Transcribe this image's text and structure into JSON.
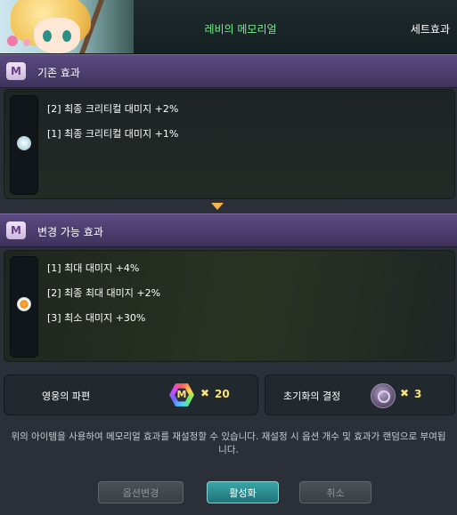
{
  "header": {
    "title": "레비의 메모리얼",
    "tab": "세트효과"
  },
  "current_section": {
    "label": "기존 효과",
    "icon_glyph": "M",
    "options": [
      "[2] 최종 크리티컬 대미지 +2%",
      "[1] 최종 크리티컬 대미지 +1%"
    ]
  },
  "new_section": {
    "label": "변경 가능 효과",
    "icon_glyph": "M",
    "options": [
      "[1] 최대 대미지 +4%",
      "[2] 최종 최대 대미지 +2%",
      "[3] 최소 대미지 +30%"
    ]
  },
  "materials": [
    {
      "name": "영웅의 파편",
      "icon": "rainbow-hexagon-icon",
      "icon_glyph": "M",
      "multiplier": "✖",
      "count": "20"
    },
    {
      "name": "초기화의 결정",
      "icon": "crystal-orb-icon",
      "multiplier": "✖",
      "count": "3"
    }
  ],
  "description": "위의 아이템을 사용하여 메모리얼 효과를 재설정할 수 있습니다. 재설정 시 옵션 개수 및 효과가 랜덤으로 부여됩니다.",
  "buttons": {
    "change": "옵션변경",
    "activate": "활성화",
    "cancel": "취소"
  },
  "colors": {
    "title": "#74f08a",
    "section_header": "#4b3d6e",
    "counts": "#f8e27a",
    "primary_button": "#2a8c8f"
  }
}
